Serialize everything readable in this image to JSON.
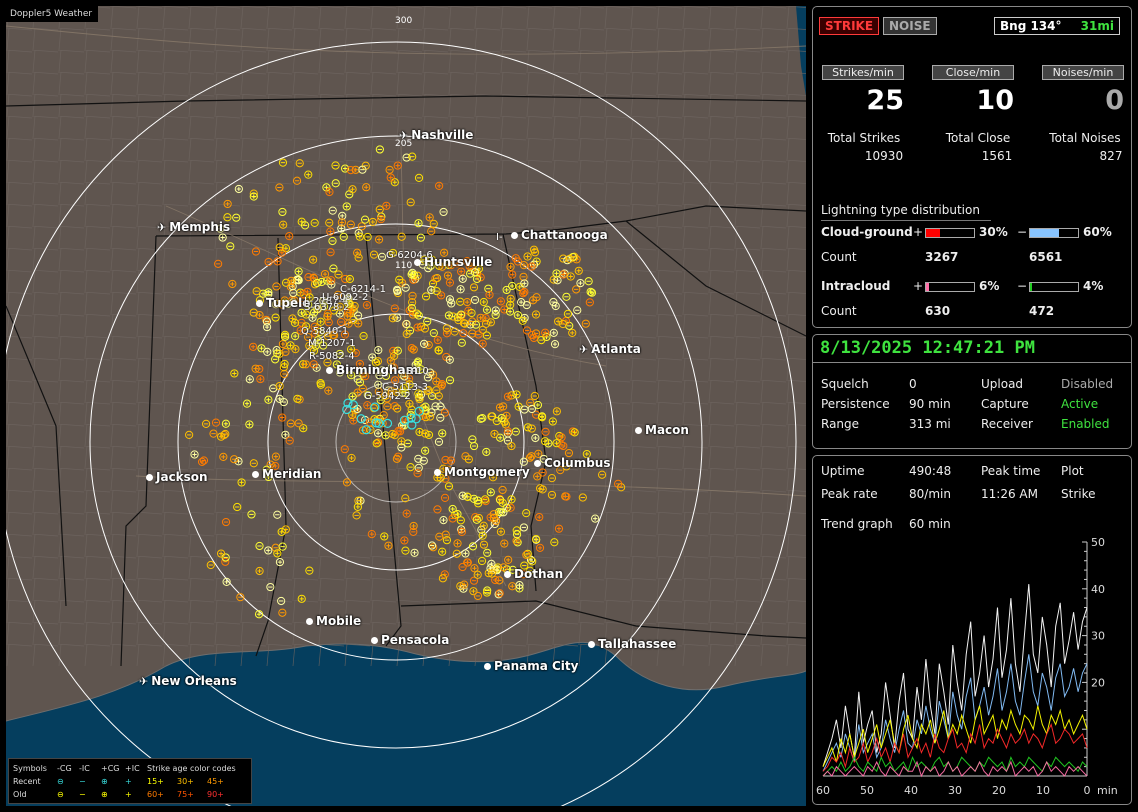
{
  "app": {
    "title": "Doppler5 Weather"
  },
  "map": {
    "ring_labels": {
      "outer": "300",
      "r205": "205",
      "r110": "110"
    },
    "cities": [
      {
        "name": "Nashville",
        "icon": "airport-icon"
      },
      {
        "name": "Memphis",
        "icon": "airport-icon"
      },
      {
        "name": "Chattanooga",
        "icon": "city-dot"
      },
      {
        "name": "Huntsville",
        "icon": "city-dot"
      },
      {
        "name": "Tupelo",
        "icon": "city-dot"
      },
      {
        "name": "Atlanta",
        "icon": "airport-icon"
      },
      {
        "name": "Birmingham",
        "icon": "city-dot"
      },
      {
        "name": "Macon",
        "icon": "city-dot"
      },
      {
        "name": "Jackson",
        "icon": "city-dot"
      },
      {
        "name": "Meridian",
        "icon": "city-dot"
      },
      {
        "name": "Montgomery",
        "icon": "city-dot"
      },
      {
        "name": "Columbus",
        "icon": "city-dot"
      },
      {
        "name": "Dothan",
        "icon": "city-dot"
      },
      {
        "name": "Mobile",
        "icon": "city-dot"
      },
      {
        "name": "Pensacola",
        "icon": "city-dot"
      },
      {
        "name": "Tallahassee",
        "icon": "city-dot"
      },
      {
        "name": "Panama City",
        "icon": "city-dot"
      },
      {
        "name": "New Orleans",
        "icon": "airport-icon"
      }
    ],
    "storm_cell_labels": [
      "G-6204-6",
      "C-6214-1",
      "L-2787-4",
      "U-6092-2",
      "S-6378-2",
      "Q-5840-1",
      "M-1207-1",
      "R-5082-4",
      "S-10",
      "C-5113-3",
      "G-5942-2",
      "I-"
    ],
    "legend": {
      "symbols_label": "Symbols",
      "cols": [
        "-CG",
        "-IC",
        "+CG",
        "+IC"
      ],
      "age_label": "Strike age color codes",
      "recent_label": "Recent",
      "old_label": "Old",
      "recent_ages": [
        "15+",
        "30+",
        "45+"
      ],
      "old_ages": [
        "60+",
        "75+",
        "90+"
      ]
    }
  },
  "status": {
    "strike_tag": "STRIKE",
    "noise_tag": "NOISE",
    "bearing": "Bng 134°",
    "distance": "31mi",
    "strikes_per_min_label": "Strikes/min",
    "close_per_min_label": "Close/min",
    "noises_per_min_label": "Noises/min",
    "strikes_per_min": "25",
    "close_per_min": "10",
    "noises_per_min": "0",
    "total_strikes_label": "Total Strikes",
    "total_close_label": "Total Close",
    "total_noises_label": "Total Noises",
    "total_strikes": "10930",
    "total_close": "1561",
    "total_noises": "827"
  },
  "distribution": {
    "title": "Lightning type distribution",
    "cg_label": "Cloud-ground",
    "ic_label": "Intracloud",
    "plus": "+",
    "minus": "−",
    "count_label": "Count",
    "cg_pos_pct": 30,
    "cg_pos_text": "30%",
    "cg_neg_pct": 60,
    "cg_neg_text": "60%",
    "ic_pos_pct": 6,
    "ic_pos_text": "6%",
    "ic_neg_pct": 4,
    "ic_neg_text": "4%",
    "cg_pos_count": "3267",
    "cg_neg_count": "6561",
    "ic_pos_count": "630",
    "ic_neg_count": "472",
    "colors": {
      "cg_pos": "#ff0000",
      "cg_neg": "#88c4ff",
      "ic_pos": "#ff6fa8",
      "ic_neg": "#22cc22"
    }
  },
  "system": {
    "datetime": "8/13/2025 12:47:21 PM",
    "squelch_label": "Squelch",
    "squelch": "0",
    "persistence_label": "Persistence",
    "persistence": "90 min",
    "range_label": "Range",
    "range": "313 mi",
    "upload_label": "Upload",
    "upload": "Disabled",
    "capture_label": "Capture",
    "capture": "Active",
    "receiver_label": "Receiver",
    "receiver": "Enabled"
  },
  "trend": {
    "uptime_label": "Uptime",
    "uptime": "490:48",
    "peak_time_label": "Peak time",
    "peak_time": "11:26 AM",
    "plot_label": "Plot",
    "plot": "Strike",
    "peak_rate_label": "Peak rate",
    "peak_rate": "80/min",
    "trend_graph_label": "Trend graph",
    "trend_graph": "60 min"
  },
  "chart_data": {
    "type": "line",
    "xlabel": "min",
    "x_ticks": [
      60,
      50,
      40,
      30,
      20,
      10,
      0
    ],
    "y_ticks": [
      20,
      30,
      40,
      50
    ],
    "xlim": [
      60,
      0
    ],
    "ylim": [
      0,
      50
    ],
    "series": [
      {
        "color": "#ffffff",
        "values": [
          2,
          5,
          8,
          12,
          6,
          15,
          9,
          4,
          18,
          7,
          11,
          14,
          5,
          9,
          20,
          13,
          6,
          16,
          22,
          10,
          8,
          19,
          12,
          25,
          15,
          9,
          24,
          18,
          11,
          28,
          20,
          14,
          26,
          33,
          17,
          22,
          30,
          19,
          25,
          36,
          21,
          27,
          38,
          24,
          18,
          30,
          41,
          26,
          22,
          34,
          28,
          19,
          32,
          37,
          24,
          29,
          35,
          27,
          33,
          36
        ]
      },
      {
        "color": "#88c4ff",
        "values": [
          1,
          3,
          5,
          7,
          4,
          9,
          6,
          3,
          11,
          5,
          7,
          9,
          4,
          6,
          12,
          8,
          5,
          10,
          14,
          7,
          6,
          12,
          9,
          15,
          10,
          7,
          16,
          12,
          8,
          18,
          13,
          10,
          17,
          21,
          12,
          15,
          19,
          13,
          17,
          23,
          14,
          18,
          24,
          16,
          13,
          20,
          26,
          18,
          15,
          22,
          19,
          14,
          21,
          24,
          17,
          19,
          23,
          18,
          22,
          24
        ]
      },
      {
        "color": "#ffff00",
        "values": [
          2,
          4,
          6,
          3,
          8,
          5,
          9,
          4,
          7,
          10,
          5,
          8,
          11,
          6,
          9,
          12,
          7,
          5,
          10,
          13,
          8,
          6,
          11,
          9,
          12,
          7,
          10,
          14,
          8,
          11,
          9,
          13,
          10,
          7,
          12,
          15,
          9,
          11,
          13,
          8,
          12,
          10,
          14,
          11,
          9,
          13,
          12,
          10,
          15,
          11,
          9,
          13,
          11,
          14,
          10,
          12,
          9,
          11,
          13,
          10
        ]
      },
      {
        "color": "#ff2a2a",
        "values": [
          1,
          2,
          4,
          3,
          5,
          2,
          6,
          3,
          4,
          7,
          3,
          5,
          8,
          4,
          6,
          3,
          7,
          5,
          9,
          4,
          6,
          8,
          5,
          7,
          4,
          9,
          6,
          5,
          8,
          10,
          6,
          7,
          5,
          9,
          7,
          11,
          6,
          8,
          7,
          10,
          8,
          6,
          9,
          7,
          8,
          10,
          7,
          9,
          8,
          6,
          9,
          11,
          7,
          8,
          10,
          9,
          7,
          8,
          9,
          6
        ]
      },
      {
        "color": "#22cc22",
        "values": [
          0,
          1,
          2,
          1,
          3,
          1,
          2,
          4,
          2,
          1,
          3,
          2,
          1,
          4,
          2,
          3,
          1,
          2,
          3,
          1,
          4,
          2,
          3,
          2,
          1,
          3,
          4,
          2,
          3,
          1,
          2,
          4,
          3,
          2,
          1,
          3,
          2,
          4,
          3,
          2,
          3,
          1,
          4,
          2,
          3,
          2,
          4,
          3,
          2,
          1,
          3,
          2,
          4,
          3,
          2,
          3,
          2,
          1,
          3,
          2
        ]
      },
      {
        "color": "#ff6fa8",
        "values": [
          0,
          1,
          0,
          2,
          1,
          0,
          1,
          2,
          1,
          0,
          2,
          1,
          3,
          1,
          0,
          2,
          1,
          0,
          2,
          1,
          1,
          3,
          0,
          2,
          1,
          2,
          0,
          1,
          3,
          1,
          2,
          0,
          1,
          2,
          1,
          3,
          1,
          0,
          2,
          1,
          2,
          1,
          3,
          0,
          1,
          2,
          1,
          2,
          0,
          1,
          3,
          1,
          2,
          1,
          0,
          2,
          1,
          2,
          1,
          0
        ]
      }
    ]
  }
}
